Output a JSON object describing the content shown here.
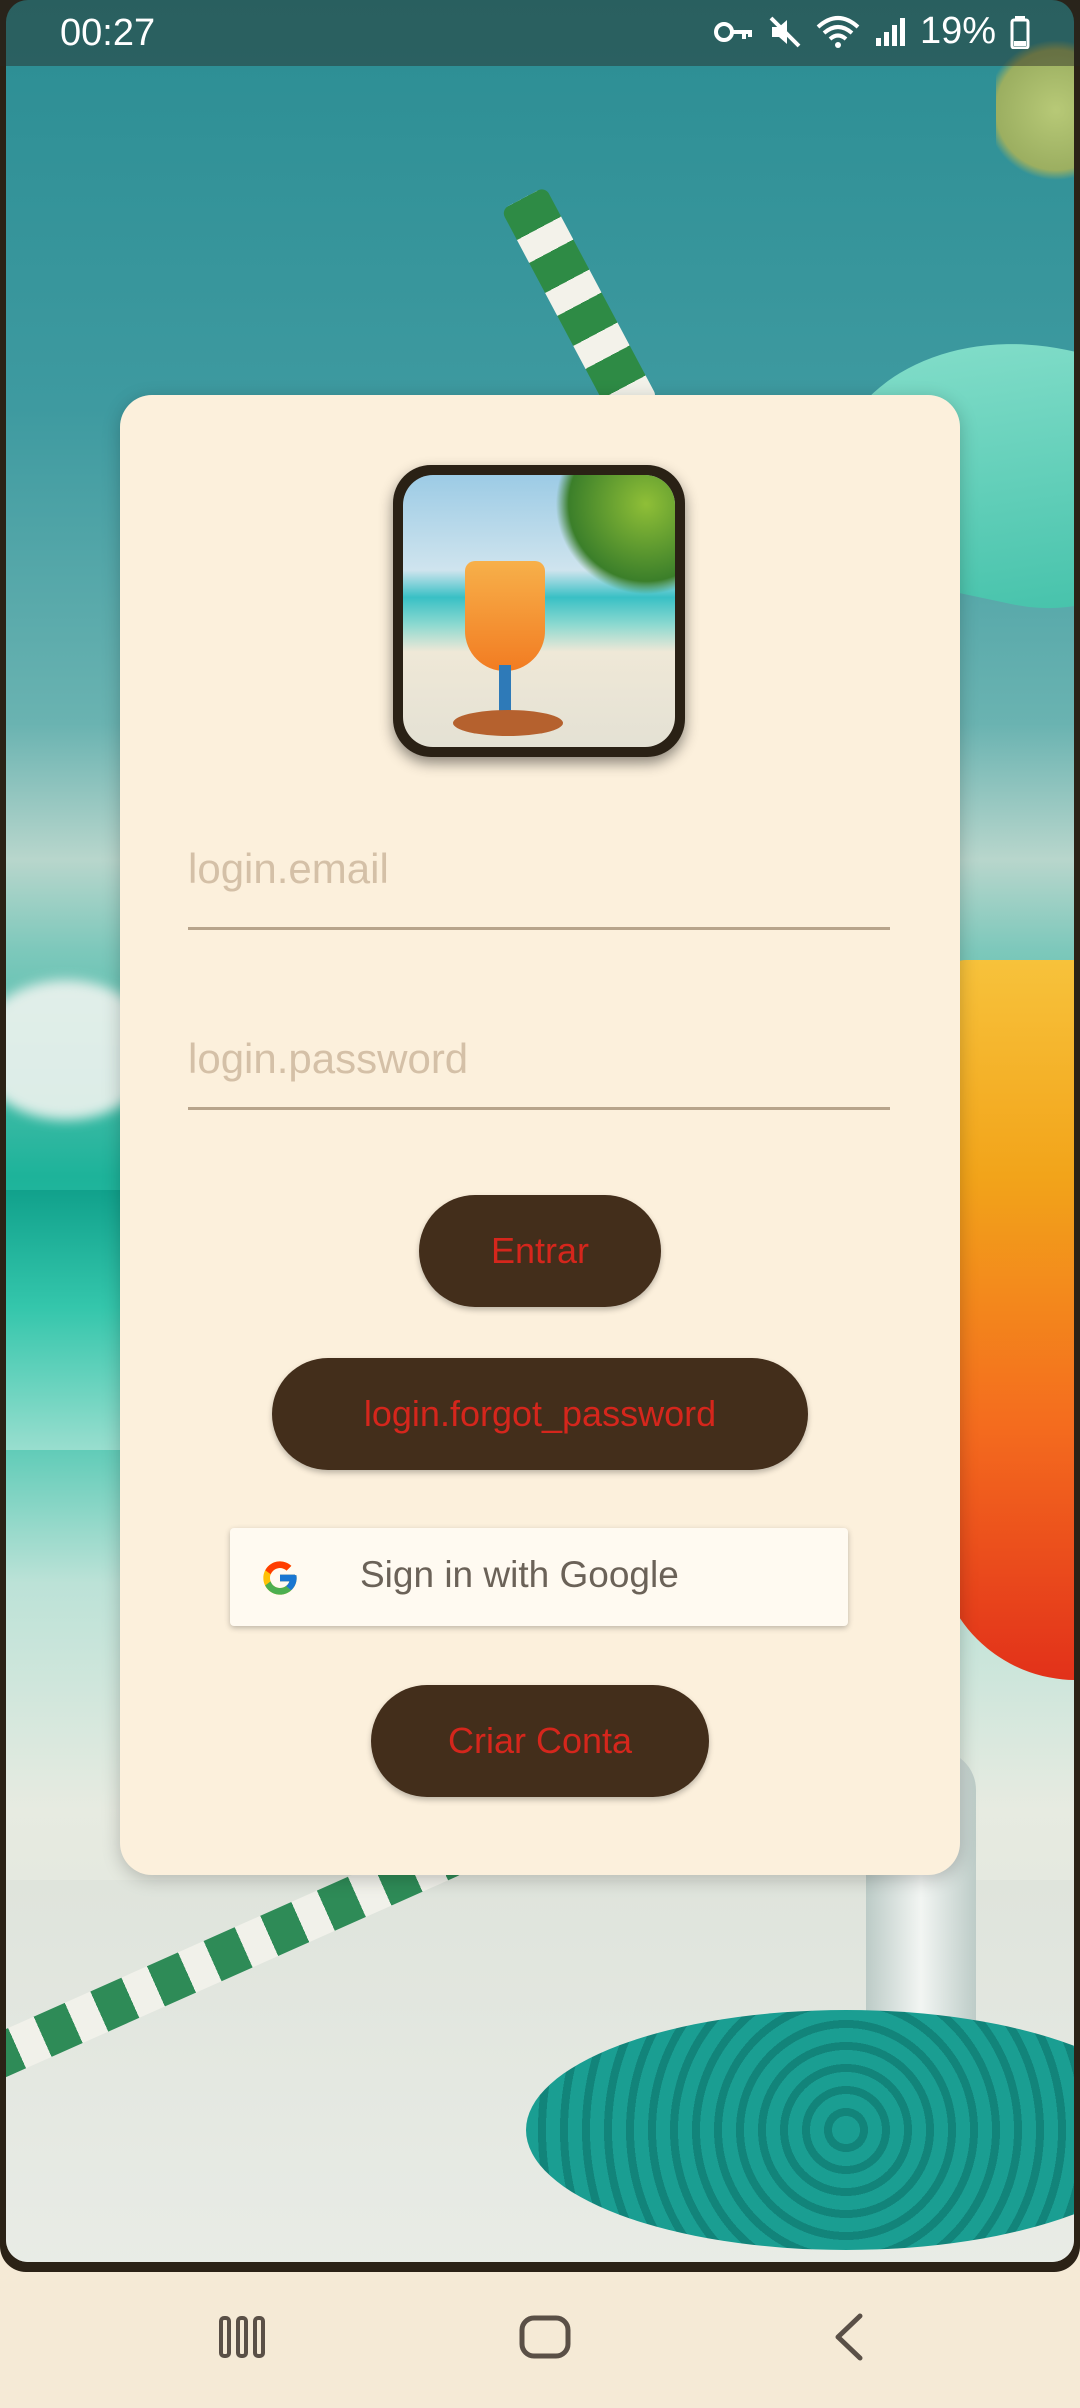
{
  "status_bar": {
    "time": "00:27",
    "battery": "19%",
    "icons": [
      "key-icon",
      "mute-icon",
      "wifi-icon",
      "signal-icon",
      "battery-icon"
    ]
  },
  "login": {
    "email_placeholder": "login.email",
    "password_placeholder": "login.password",
    "enter_label": "Entrar",
    "forgot_label": "login.forgot_password",
    "google_label": "Sign in with Google",
    "create_label": "Criar Conta"
  },
  "colors": {
    "card_bg": "#fcf0dc",
    "button_bg": "#432e1b",
    "button_text": "#d5261c",
    "underline": "#b7a48b"
  },
  "nav_bar": {
    "icons": [
      "recents-icon",
      "home-icon",
      "back-icon"
    ]
  }
}
